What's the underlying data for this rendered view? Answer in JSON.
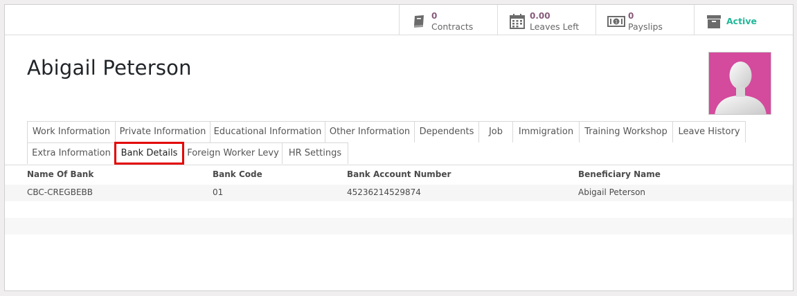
{
  "stats": {
    "contracts": {
      "value": "0",
      "label": "Contracts",
      "icon": "book-icon"
    },
    "leaves": {
      "value": "0.00",
      "label": "Leaves Left",
      "icon": "calendar-icon"
    },
    "payslips": {
      "value": "0",
      "label": "Payslips",
      "icon": "money-icon"
    },
    "active": {
      "label": "Active",
      "icon": "archive-icon"
    }
  },
  "employee": {
    "name": "Abigail Peterson"
  },
  "tabs": [
    "Work Information",
    "Private Information",
    "Educational Information",
    "Other Information",
    "Dependents",
    "Job",
    "Immigration",
    "Training Workshop",
    "Leave History",
    "Extra Information",
    "Bank Details",
    "Foreign Worker Levy",
    "HR Settings"
  ],
  "selected_tab": "Bank Details",
  "table": {
    "headers": [
      "Name Of Bank",
      "Bank Code",
      "Bank Account Number",
      "Beneficiary Name"
    ],
    "rows": [
      [
        "CBC-CREGBEBB",
        "01",
        "45236214529874",
        "Abigail Peterson"
      ]
    ]
  },
  "colors": {
    "accent": "#875a7b",
    "active": "#21b799",
    "highlight": "#e30000",
    "avatar_bg": "#d44a9c"
  }
}
